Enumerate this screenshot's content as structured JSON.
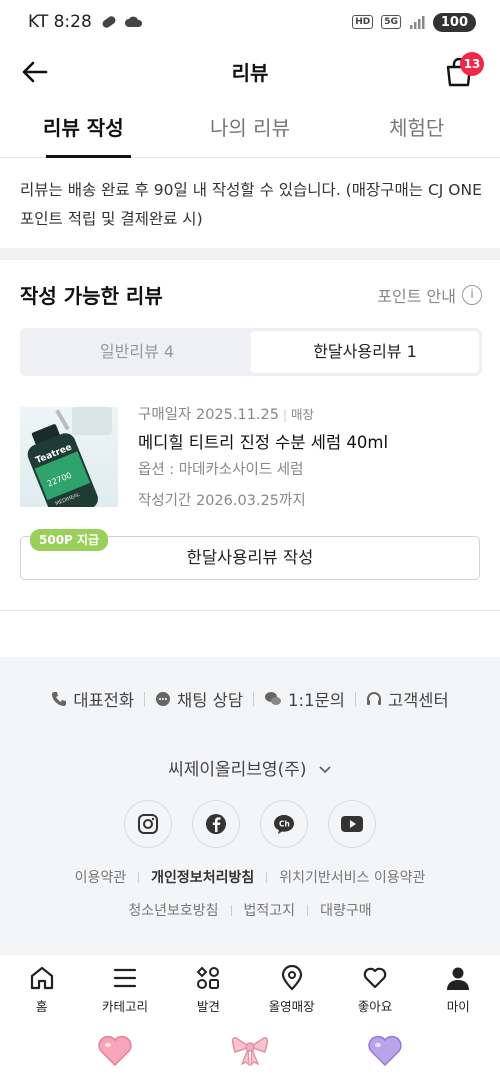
{
  "status_bar": {
    "carrier_time": "KT 8:28",
    "battery": "100",
    "hd": "HD",
    "network": "5G"
  },
  "header": {
    "title": "리뷰",
    "cart_count": "13"
  },
  "tabs": [
    {
      "label": "리뷰 작성",
      "active": true
    },
    {
      "label": "나의 리뷰",
      "active": false
    },
    {
      "label": "체험단",
      "active": false
    }
  ],
  "notice": "리뷰는 배송 완료 후 90일 내 작성할 수 있습니다. (매장구매는 CJ ONE 포인트 적립 및 결제완료 시)",
  "section": {
    "title": "작성 가능한 리뷰",
    "point_guide": "포인트 안내",
    "segments": [
      {
        "label": "일반리뷰 4",
        "active": false
      },
      {
        "label": "한달사용리뷰 1",
        "active": true
      }
    ]
  },
  "product": {
    "purchase_date": "구매일자 2025.11.25",
    "store": "매장",
    "name": "메디힐 티트리 진정 수분 세럼 40ml",
    "option": "옵션 : 마데카소사이드 세럼",
    "period": "작성기간 2026.03.25까지",
    "thumb_text_1": "Teatree",
    "thumb_text_2": "22700",
    "thumb_text_3": "MEDIHEAL"
  },
  "write": {
    "point_badge": "500P 지급",
    "button_label": "한달사용리뷰 작성"
  },
  "footer": {
    "contacts": [
      "대표전화",
      "채팅 상담",
      "1:1문의",
      "고객센터"
    ],
    "company": "씨제이올리브영(주)",
    "links_row1": [
      "이용약관",
      "개인정보처리방침",
      "위치기반서비스 이용약관"
    ],
    "links_row2": [
      "청소년보호방침",
      "법적고지",
      "대량구매"
    ],
    "socials": [
      "instagram-icon",
      "facebook-icon",
      "kakao-channel-icon",
      "youtube-icon"
    ]
  },
  "bottom_nav": [
    {
      "label": "홈",
      "icon": "home-icon"
    },
    {
      "label": "카테고리",
      "icon": "menu-icon"
    },
    {
      "label": "발견",
      "icon": "discover-icon"
    },
    {
      "label": "올영매장",
      "icon": "location-pin-icon"
    },
    {
      "label": "좋아요",
      "icon": "heart-icon"
    },
    {
      "label": "마이",
      "icon": "person-icon"
    }
  ],
  "colors": {
    "badge_red": "#f0284a",
    "point_green": "#9ad05a",
    "footer_bg": "#f4f5f7"
  }
}
